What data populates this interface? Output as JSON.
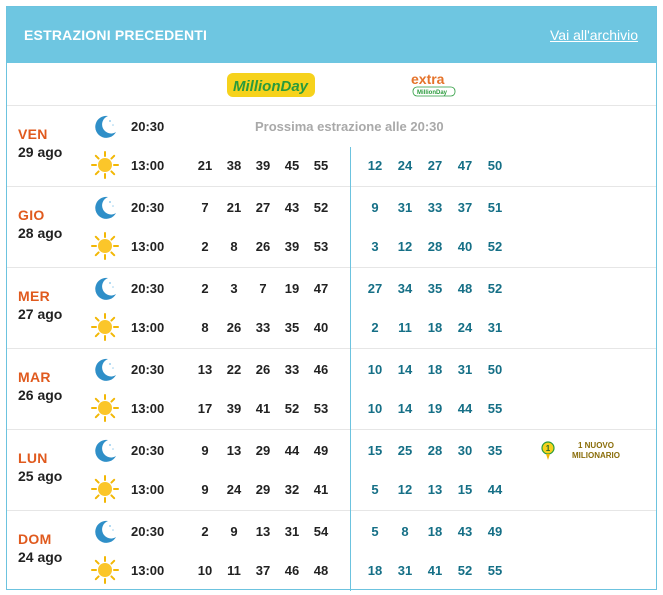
{
  "header": {
    "title": "ESTRAZIONI PRECEDENTI",
    "archive_link": "Vai all'archivio"
  },
  "logos": {
    "million": "MillionDay",
    "extra_main": "extra",
    "extra_sub": "MillionDay"
  },
  "colors": {
    "header_bg": "#6ec6e1",
    "day_name": "#e05a1e",
    "extra_numbers": "#156f86",
    "next_draw_text": "#a9a9a9"
  },
  "icons": {
    "evening": "moon-icon",
    "midday": "sun-icon",
    "millionaire": "coin-icon"
  },
  "days": [
    {
      "name": "VEN",
      "date": "29 ago",
      "evening": {
        "time": "20:30",
        "next_draw": "Prossima estrazione alle 20:30"
      },
      "midday": {
        "time": "13:00",
        "main": [
          "21",
          "38",
          "39",
          "45",
          "55"
        ],
        "extra": [
          "12",
          "24",
          "27",
          "47",
          "50"
        ]
      }
    },
    {
      "name": "GIO",
      "date": "28 ago",
      "evening": {
        "time": "20:30",
        "main": [
          "7",
          "21",
          "27",
          "43",
          "52"
        ],
        "extra": [
          "9",
          "31",
          "33",
          "37",
          "51"
        ]
      },
      "midday": {
        "time": "13:00",
        "main": [
          "2",
          "8",
          "26",
          "39",
          "53"
        ],
        "extra": [
          "3",
          "12",
          "28",
          "40",
          "52"
        ]
      }
    },
    {
      "name": "MER",
      "date": "27 ago",
      "evening": {
        "time": "20:30",
        "main": [
          "2",
          "3",
          "7",
          "19",
          "47"
        ],
        "extra": [
          "27",
          "34",
          "35",
          "48",
          "52"
        ]
      },
      "midday": {
        "time": "13:00",
        "main": [
          "8",
          "26",
          "33",
          "35",
          "40"
        ],
        "extra": [
          "2",
          "11",
          "18",
          "24",
          "31"
        ]
      }
    },
    {
      "name": "MAR",
      "date": "26 ago",
      "evening": {
        "time": "20:30",
        "main": [
          "13",
          "22",
          "26",
          "33",
          "46"
        ],
        "extra": [
          "10",
          "14",
          "18",
          "31",
          "50"
        ]
      },
      "midday": {
        "time": "13:00",
        "main": [
          "17",
          "39",
          "41",
          "52",
          "53"
        ],
        "extra": [
          "10",
          "14",
          "19",
          "44",
          "55"
        ]
      }
    },
    {
      "name": "LUN",
      "date": "25 ago",
      "evening": {
        "time": "20:30",
        "main": [
          "9",
          "13",
          "29",
          "44",
          "49"
        ],
        "extra": [
          "15",
          "25",
          "28",
          "30",
          "35"
        ],
        "badge_count": "1",
        "badge_line1": "1 NUOVO",
        "badge_line2": "MILIONARIO"
      },
      "midday": {
        "time": "13:00",
        "main": [
          "9",
          "24",
          "29",
          "32",
          "41"
        ],
        "extra": [
          "5",
          "12",
          "13",
          "15",
          "44"
        ]
      }
    },
    {
      "name": "DOM",
      "date": "24 ago",
      "evening": {
        "time": "20:30",
        "main": [
          "2",
          "9",
          "13",
          "31",
          "54"
        ],
        "extra": [
          "5",
          "8",
          "18",
          "43",
          "49"
        ]
      },
      "midday": {
        "time": "13:00",
        "main": [
          "10",
          "11",
          "37",
          "46",
          "48"
        ],
        "extra": [
          "18",
          "31",
          "41",
          "52",
          "55"
        ]
      }
    }
  ]
}
